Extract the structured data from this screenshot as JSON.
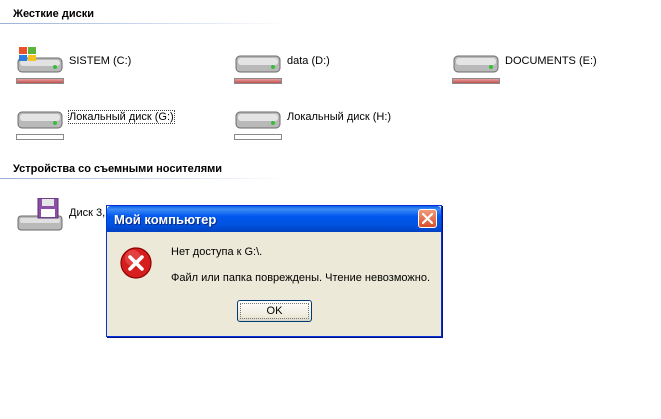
{
  "groups": {
    "hard_disks": "Жесткие диски",
    "removable": "Устройства со съемными носителями"
  },
  "drives": [
    {
      "label": "SISTEM (C:)",
      "icon": "system-drive-icon",
      "usage": 1.0
    },
    {
      "label": "data (D:)",
      "icon": "hard-drive-icon",
      "usage": 1.0
    },
    {
      "label": "DOCUMENTS (E:)",
      "icon": "hard-drive-icon",
      "usage": 1.0
    },
    {
      "label": "Локальный диск (G:)",
      "icon": "hard-drive-icon",
      "usage": 0.0,
      "selected": true
    },
    {
      "label": "Локальный диск (H:)",
      "icon": "hard-drive-icon",
      "usage": 0.0
    }
  ],
  "removable": [
    {
      "label": "Диск 3,",
      "icon": "floppy-drive-icon"
    }
  ],
  "dialog": {
    "title": "Мой компьютер",
    "line1": "Нет доступа к G:\\.",
    "line2": "Файл или папка повреждены. Чтение невозможно.",
    "ok": "OK",
    "icon": "error-icon"
  },
  "colors": {
    "usage_bar": "#c0504d",
    "title_bar": "#0054e3",
    "dialog_bg": "#ece9d8",
    "close_button": "#e0603a"
  }
}
